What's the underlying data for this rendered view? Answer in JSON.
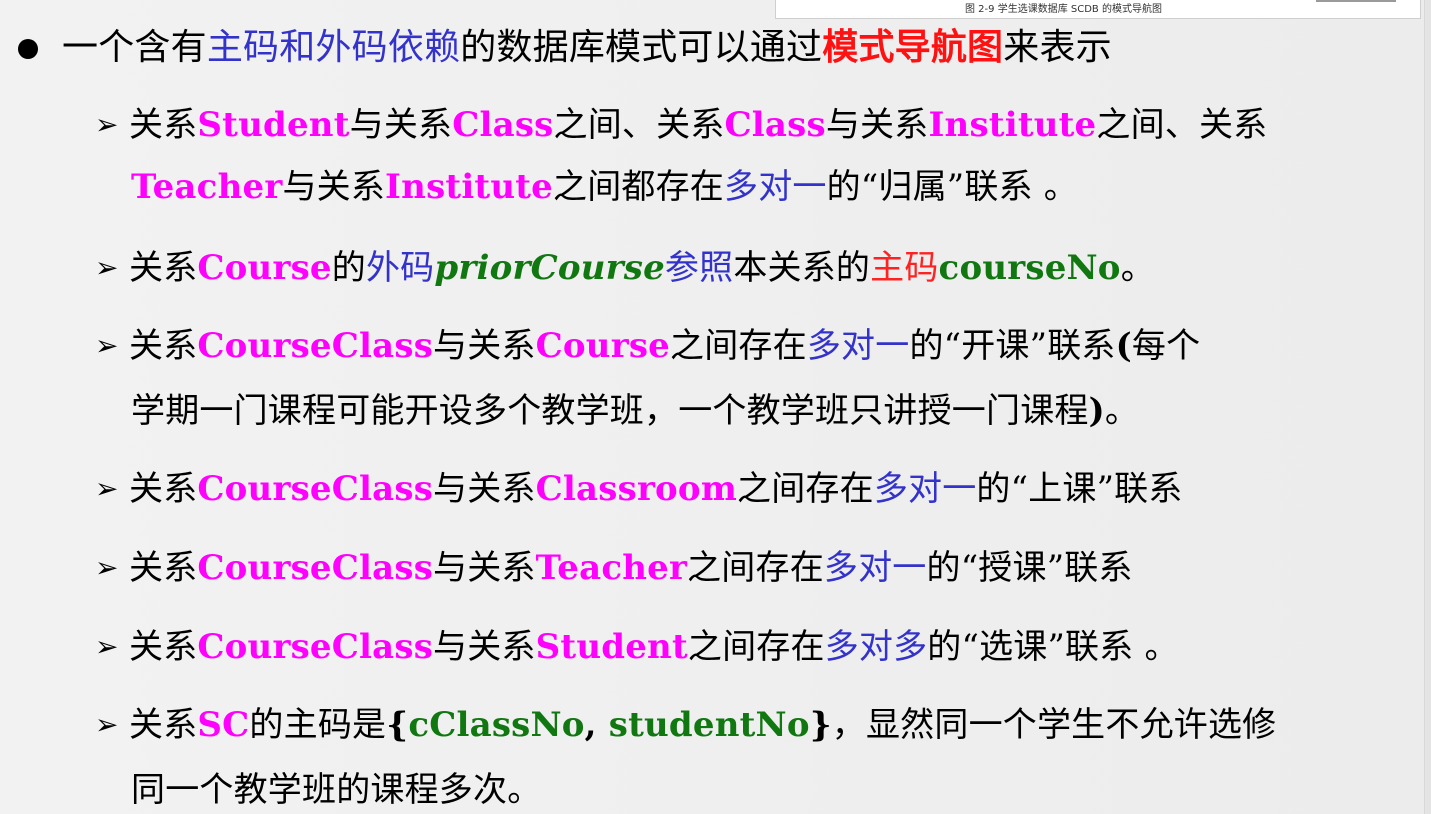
{
  "figure": {
    "caption": "图 2-9 学生选课数据库 SCDB 的模式导航图"
  },
  "main_bullet": [
    {
      "text": "一个含有",
      "style": "black"
    },
    {
      "text": "主码和外码依赖",
      "style": "blue"
    },
    {
      "text": "的数据库模式可以通过",
      "style": "black"
    },
    {
      "text": "模式导航图",
      "style": "redb"
    },
    {
      "text": "来表示",
      "style": "black"
    }
  ],
  "lines": [
    {
      "arrow": "➢",
      "segments": [
        {
          "text": "关系",
          "style": "black"
        },
        {
          "text": "Student",
          "style": "mag"
        },
        {
          "text": "与关系",
          "style": "black"
        },
        {
          "text": "Class",
          "style": "mag"
        },
        {
          "text": "之间、关系",
          "style": "black"
        },
        {
          "text": "Class",
          "style": "mag"
        },
        {
          "text": "与关系",
          "style": "black"
        },
        {
          "text": "Institute",
          "style": "mag"
        },
        {
          "text": "之间、关系",
          "style": "black"
        }
      ]
    },
    {
      "arrow": "",
      "segments": [
        {
          "text": "Teacher",
          "style": "mag"
        },
        {
          "text": "与关系",
          "style": "black"
        },
        {
          "text": "Institute",
          "style": "mag"
        },
        {
          "text": "之间都存在",
          "style": "black"
        },
        {
          "text": "多对一",
          "style": "blue"
        },
        {
          "text": "的“归属”联系 。",
          "style": "black"
        }
      ]
    },
    {
      "arrow": "➢",
      "segments": [
        {
          "text": "关系",
          "style": "black"
        },
        {
          "text": "Course",
          "style": "mag"
        },
        {
          "text": "的",
          "style": "black"
        },
        {
          "text": "外码",
          "style": "blue"
        },
        {
          "text": "priorCourse",
          "style": "greeni"
        },
        {
          "text": "参照",
          "style": "blue"
        },
        {
          "text": "本关系的",
          "style": "black"
        },
        {
          "text": "主码",
          "style": "red"
        },
        {
          "text": "courseNo",
          "style": "green"
        },
        {
          "text": "。",
          "style": "black"
        }
      ]
    },
    {
      "arrow": "➢",
      "segments": [
        {
          "text": "关系",
          "style": "black"
        },
        {
          "text": "CourseClass",
          "style": "mag"
        },
        {
          "text": "与关系",
          "style": "black"
        },
        {
          "text": "Course",
          "style": "mag"
        },
        {
          "text": "之间存在",
          "style": "black"
        },
        {
          "text": "多对一",
          "style": "blue"
        },
        {
          "text": "的“开课”联系",
          "style": "black"
        },
        {
          "text": "(",
          "style": "blackb"
        },
        {
          "text": "每个",
          "style": "black"
        }
      ]
    },
    {
      "arrow": "",
      "segments": [
        {
          "text": "学期一门课程可能开设多个教学班，一个教学班只讲授一门课程",
          "style": "black"
        },
        {
          "text": ")",
          "style": "blackb"
        },
        {
          "text": "。",
          "style": "black"
        }
      ]
    },
    {
      "arrow": "➢",
      "segments": [
        {
          "text": "关系",
          "style": "black"
        },
        {
          "text": "CourseClass",
          "style": "mag"
        },
        {
          "text": "与关系",
          "style": "black"
        },
        {
          "text": "Classroom",
          "style": "mag"
        },
        {
          "text": "之间存在",
          "style": "black"
        },
        {
          "text": "多对一",
          "style": "blue"
        },
        {
          "text": "的“上课”联系",
          "style": "black"
        }
      ]
    },
    {
      "arrow": "➢",
      "segments": [
        {
          "text": "关系",
          "style": "black"
        },
        {
          "text": "CourseClass",
          "style": "mag"
        },
        {
          "text": "与关系",
          "style": "black"
        },
        {
          "text": "Teacher",
          "style": "mag"
        },
        {
          "text": "之间存在",
          "style": "black"
        },
        {
          "text": "多对一",
          "style": "blue"
        },
        {
          "text": "的“授课”联系",
          "style": "black"
        }
      ]
    },
    {
      "arrow": "➢",
      "segments": [
        {
          "text": "关系",
          "style": "black"
        },
        {
          "text": "CourseClass",
          "style": "mag"
        },
        {
          "text": "与关系",
          "style": "black"
        },
        {
          "text": "Student",
          "style": "mag"
        },
        {
          "text": "之间存在",
          "style": "black"
        },
        {
          "text": "多对多",
          "style": "blue"
        },
        {
          "text": "的“选课”联系 。",
          "style": "black"
        }
      ]
    },
    {
      "arrow": "➢",
      "segments": [
        {
          "text": "关系",
          "style": "black"
        },
        {
          "text": "SC",
          "style": "mag"
        },
        {
          "text": "的主码是",
          "style": "black"
        },
        {
          "text": "{",
          "style": "blackb"
        },
        {
          "text": "cClassNo",
          "style": "green"
        },
        {
          "text": ", ",
          "style": "blackb"
        },
        {
          "text": "studentNo",
          "style": "green"
        },
        {
          "text": "}",
          "style": "blackb"
        },
        {
          "text": "，显然同一个学生不允许选修",
          "style": "black"
        }
      ]
    },
    {
      "arrow": "",
      "segments": [
        {
          "text": "同一个教学班的课程多次。",
          "style": "black"
        }
      ]
    }
  ]
}
